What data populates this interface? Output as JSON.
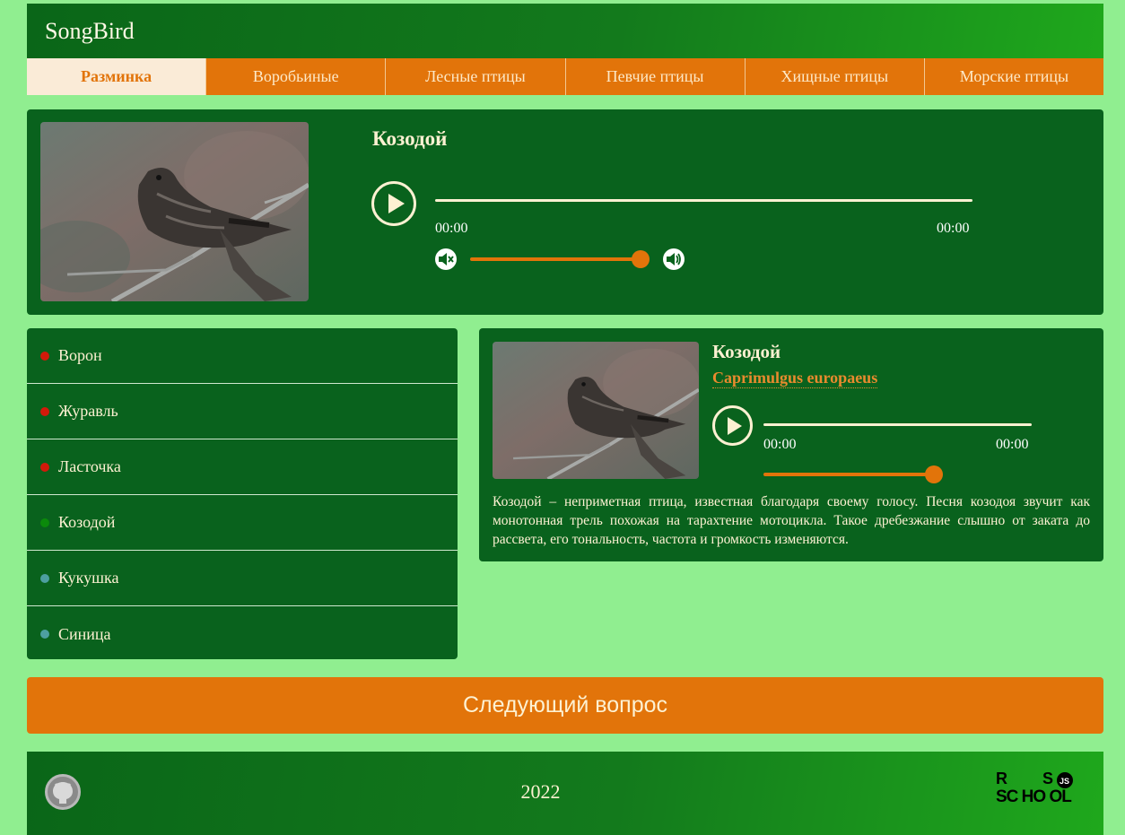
{
  "header": {
    "logo": "SongBird"
  },
  "nav": {
    "items": [
      {
        "label": "Разминка",
        "active": true
      },
      {
        "label": "Воробьиные",
        "active": false
      },
      {
        "label": "Лесные птицы",
        "active": false
      },
      {
        "label": "Певчие птицы",
        "active": false
      },
      {
        "label": "Хищные птицы",
        "active": false
      },
      {
        "label": "Морские птицы",
        "active": false
      }
    ]
  },
  "question": {
    "title": "Козодой",
    "player": {
      "current_time": "00:00",
      "duration": "00:00",
      "volume_fraction": 0.95
    }
  },
  "answers": {
    "items": [
      {
        "label": "Ворон",
        "status_color": "#d21a0a"
      },
      {
        "label": "Журавль",
        "status_color": "#d21a0a"
      },
      {
        "label": "Ласточка",
        "status_color": "#d21a0a"
      },
      {
        "label": "Козодой",
        "status_color": "#0b8a0b"
      },
      {
        "label": "Кукушка",
        "status_color": "#4d9fa0"
      },
      {
        "label": "Синица",
        "status_color": "#4d9fa0"
      }
    ]
  },
  "description": {
    "name": "Козодой",
    "latin": "Caprimulgus europaeus",
    "player": {
      "current_time": "00:00",
      "duration": "00:00",
      "volume_fraction": 0.95
    },
    "text": "Козодой – неприметная птица, известная благодаря своему голосу. Песня козодоя звучит как монотонная трель похожая на тарахтение мотоцикла. Такое дребезжание слышно от заката до рассвета, его тональность, частота и громкость изменяются."
  },
  "next_button": {
    "label": "Следующий вопрос"
  },
  "footer": {
    "year": "2022",
    "github_icon": "github-icon",
    "school_logo": "RS SCHOOL JS"
  },
  "colors": {
    "background": "#90ee90",
    "panel": "#09621d",
    "accent": "#e2740a",
    "text_light": "#fdf1d2"
  }
}
